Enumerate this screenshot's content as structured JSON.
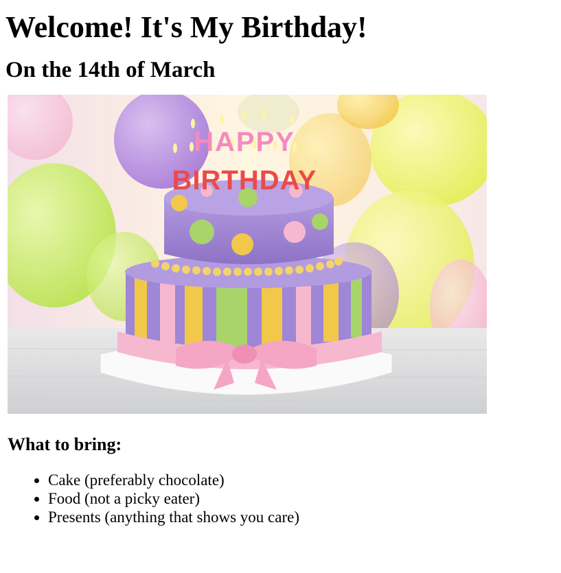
{
  "page": {
    "heading": "Welcome! It's My Birthday!",
    "subheading": "On the 14th of March",
    "image": {
      "alt": "Birthday cake with HAPPY BIRTHDAY candles in front of balloons",
      "candles_top": "HAPPY",
      "candles_bottom": "BIRTHDAY"
    },
    "list_title": "What to bring:",
    "items": [
      "Cake (preferably chocolate)",
      "Food (not a picky eater)",
      "Presents (anything that shows you care)"
    ]
  },
  "colors": {
    "text": "#000000",
    "background": "#ffffff",
    "cake_purple": "#9b7fd0",
    "ribbon_pink": "#f6b8cf",
    "stripe_yellow": "#f1c84a",
    "stripe_green": "#a8d46a"
  }
}
